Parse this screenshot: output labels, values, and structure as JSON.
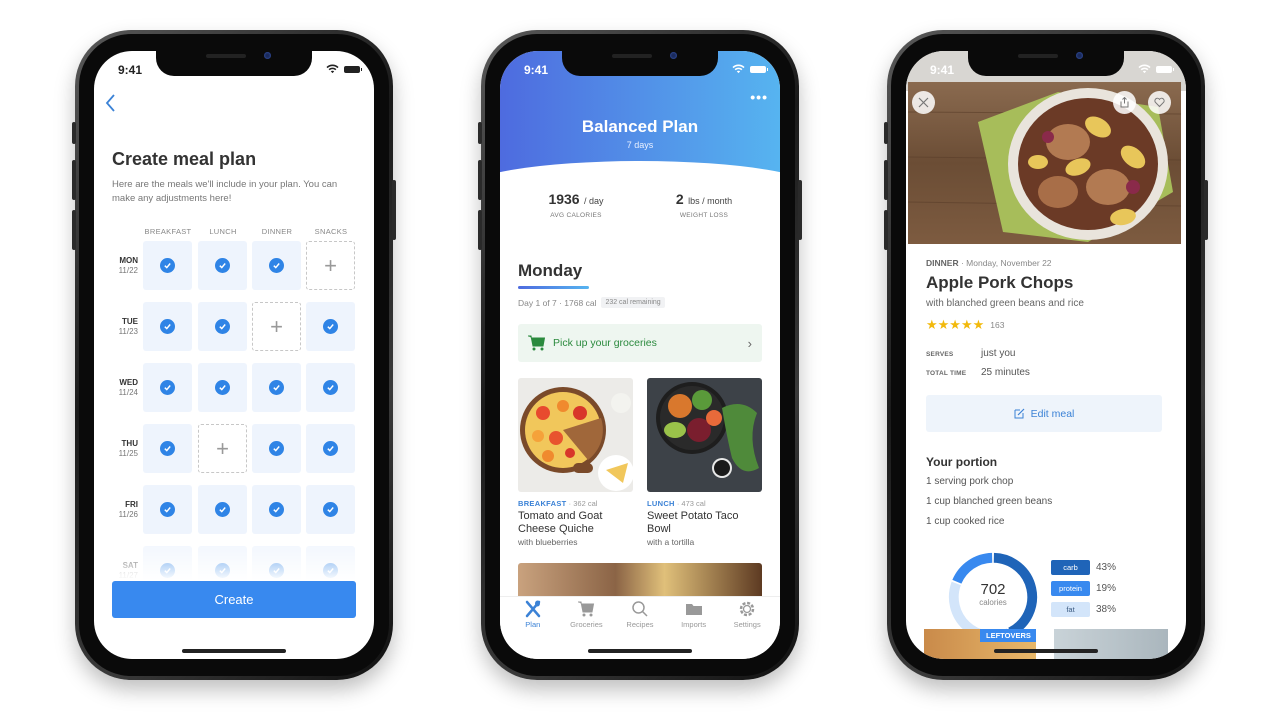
{
  "status": {
    "time": "9:41"
  },
  "colors": {
    "primary_blue": "#3889ef",
    "check_blue": "#2f84e6",
    "gradient_start": "#4e6bdf",
    "gradient_end": "#56b4f0",
    "grocery_green": "#2b8a3e",
    "star_gold": "#f2b90c"
  },
  "create_plan": {
    "back_icon": "chevron-left-icon",
    "title": "Create meal plan",
    "description": "Here are the meals we'll include in your plan. You can make any adjustments here!",
    "columns": [
      "BREAKFAST",
      "LUNCH",
      "DINNER",
      "SNACKS"
    ],
    "rows": [
      {
        "day": "MON",
        "date": "11/22",
        "meals": [
          true,
          true,
          true,
          false
        ]
      },
      {
        "day": "TUE",
        "date": "11/23",
        "meals": [
          true,
          true,
          false,
          true
        ]
      },
      {
        "day": "WED",
        "date": "11/24",
        "meals": [
          true,
          true,
          true,
          true
        ]
      },
      {
        "day": "THU",
        "date": "11/25",
        "meals": [
          true,
          false,
          true,
          true
        ]
      },
      {
        "day": "FRI",
        "date": "11/26",
        "meals": [
          true,
          true,
          true,
          true
        ]
      },
      {
        "day": "SAT",
        "date": "11/27",
        "meals": [
          true,
          true,
          true,
          true
        ]
      }
    ],
    "create_button": "Create"
  },
  "plan": {
    "more_icon": "•••",
    "title": "Balanced Plan",
    "subtitle": "7 days",
    "stats": [
      {
        "value": "1936",
        "unit": "/ day",
        "label": "AVG CALORIES"
      },
      {
        "value": "2",
        "unit": "lbs / month",
        "label": "WEIGHT LOSS"
      }
    ],
    "day_title": "Monday",
    "day_info": "Day 1 of 7 · 1768 cal",
    "remaining": "232 cal remaining",
    "grocery_label": "Pick up your groceries",
    "meals": [
      {
        "type": "BREAKFAST",
        "cal": "· 362 cal",
        "name": "Tomato and Goat Cheese Quiche",
        "sub": "with blueberries"
      },
      {
        "type": "LUNCH",
        "cal": "· 473 cal",
        "name": "Sweet Potato Taco Bowl",
        "sub": "with a tortilla"
      }
    ],
    "tabs": [
      {
        "label": "Plan",
        "icon": "utensils-icon",
        "active": true
      },
      {
        "label": "Groceries",
        "icon": "cart-icon",
        "active": false
      },
      {
        "label": "Recipes",
        "icon": "search-icon",
        "active": false
      },
      {
        "label": "Imports",
        "icon": "folder-icon",
        "active": false
      },
      {
        "label": "Settings",
        "icon": "gear-icon",
        "active": false
      }
    ]
  },
  "recipe": {
    "meal_type": "DINNER",
    "date": "· Monday, November 22",
    "title": "Apple Pork Chops",
    "subtitle": "with blanched green beans and rice",
    "stars": "★★★★★",
    "rating_count": "163",
    "serves_label": "SERVES",
    "serves_value": "just you",
    "time_label": "TOTAL TIME",
    "time_value": "25 minutes",
    "edit_button": "Edit meal",
    "portion_title": "Your portion",
    "portion_items": [
      "1 serving pork chop",
      "1 cup blanched green beans",
      "1 cup cooked rice"
    ],
    "calories": "702",
    "calories_label": "calories",
    "macros": [
      {
        "name": "carb",
        "pct": "43%",
        "value": 43,
        "color": "#1f64b8",
        "text": "#ffffff"
      },
      {
        "name": "protein",
        "pct": "19%",
        "value": 19,
        "color": "#3889ef",
        "text": "#ffffff"
      },
      {
        "name": "fat",
        "pct": "38%",
        "value": 38,
        "color": "#d3e5fa",
        "text": "#3b5a80"
      }
    ],
    "leftovers_badge": "LEFTOVERS"
  }
}
